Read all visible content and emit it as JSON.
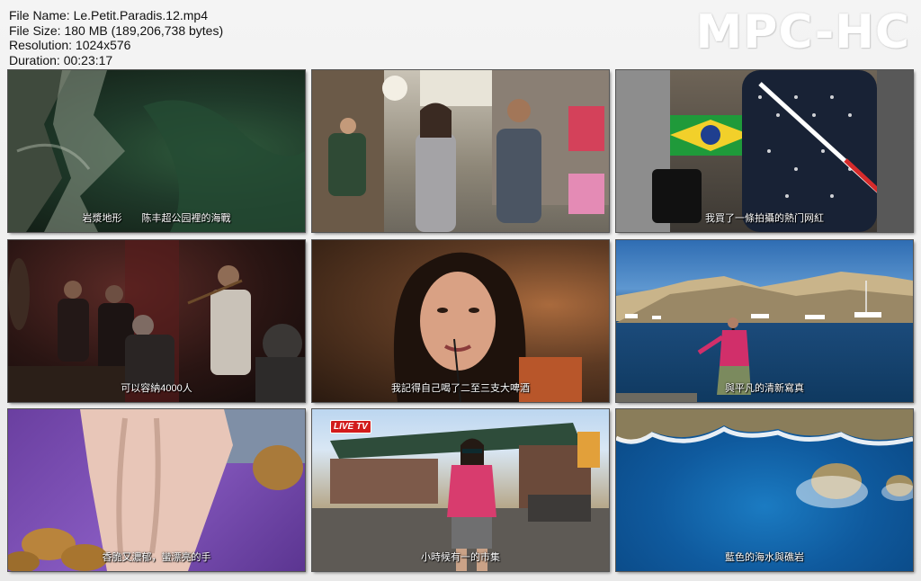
{
  "file_info": {
    "name_line": "File Name: Le.Petit.Paradis.12.mp4",
    "size_line": "File Size: 180 MB (189,206,738 bytes)",
    "resolution_line": "Resolution: 1024x576",
    "duration_line": "Duration: 00:23:17"
  },
  "brand": "MPC-HC",
  "thumbnails": [
    {
      "subtitle": "岩漿地形　　陈丰超公园裡的海戰",
      "scene": "rock-cliff"
    },
    {
      "subtitle": "",
      "scene": "street-walk"
    },
    {
      "subtitle": "我買了一條拍攝的熱门网紅",
      "scene": "market-stall"
    },
    {
      "subtitle": "可以容納4000人",
      "scene": "jazz-bar"
    },
    {
      "subtitle": "我記得自己喝了二至三支大啤酒",
      "scene": "woman-closeup"
    },
    {
      "subtitle": "與平凡的清新寫真",
      "scene": "harbor"
    },
    {
      "subtitle": "香脆又濃郁，蠻漂亮的手",
      "scene": "food-hand"
    },
    {
      "subtitle": "小時候有一的市集",
      "scene": "market-host",
      "logo": "LIVE TV"
    },
    {
      "subtitle": "藍色的海水與礁岩",
      "scene": "aerial-sea"
    }
  ],
  "colors": {
    "brand_text": "#ffffff",
    "background": "#efefef"
  }
}
